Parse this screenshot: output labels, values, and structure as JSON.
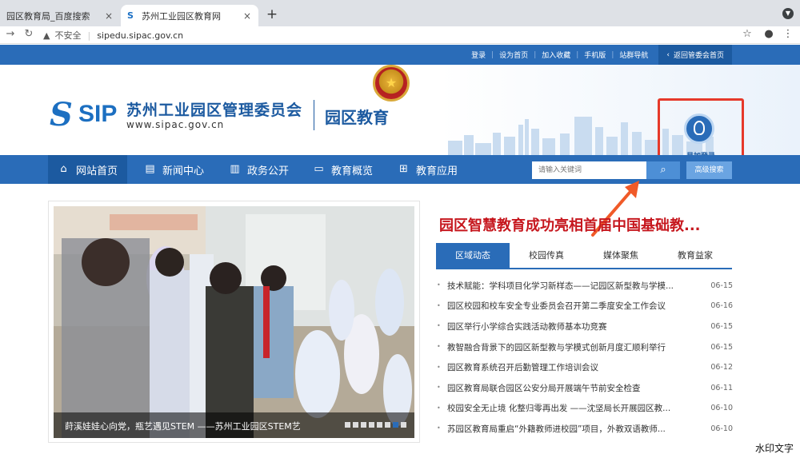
{
  "browser": {
    "tabs": [
      {
        "label": "园区教育局_百度搜索",
        "active": false
      },
      {
        "label": "苏州工业园区教育网",
        "active": true
      }
    ],
    "new_tab": "+",
    "tab_close": "×",
    "address": {
      "security_label": "不安全",
      "url": "sipedu.sipac.gov.cn"
    }
  },
  "topbar": {
    "links": [
      "登录",
      "设为首页",
      "加入收藏",
      "手机版",
      "站群导航"
    ],
    "back_link": "返回管委会首页"
  },
  "header": {
    "logo_text": "SIP",
    "org_name": "苏州工业园区管理委员会",
    "org_url": "www.sipac.gov.cn",
    "section_name": "园区教育",
    "login_label": "易加登录"
  },
  "nav": {
    "items": [
      {
        "label": "网站首页",
        "icon": "home-icon"
      },
      {
        "label": "新闻中心",
        "icon": "newspaper-icon"
      },
      {
        "label": "政务公开",
        "icon": "book-icon"
      },
      {
        "label": "教育概览",
        "icon": "monitor-icon"
      },
      {
        "label": "教育应用",
        "icon": "apps-icon"
      }
    ],
    "search_placeholder": "请输入关键词",
    "advanced_search": "高级搜索"
  },
  "carousel": {
    "caption": "莳溪娃娃心向党，瓶艺遇见STEM  ——苏州工业园区STEM艺",
    "slide_count": 8,
    "active_slide": 7
  },
  "news": {
    "headline": "园区智慧教育成功亮相首届中国基础教...",
    "tabs": [
      "区域动态",
      "校园传真",
      "媒体聚焦",
      "教育益家"
    ],
    "active_tab": 0,
    "items": [
      {
        "title": "技术赋能：学科项目化学习新样态——记园区新型教与学模...",
        "date": "06-15"
      },
      {
        "title": "园区校园和校车安全专业委员会召开第二季度安全工作会议",
        "date": "06-16"
      },
      {
        "title": "园区举行小学综合实践活动教师基本功竞赛",
        "date": "06-15"
      },
      {
        "title": "教智融合背景下的园区新型教与学模式创新月度汇顺利举行",
        "date": "06-15"
      },
      {
        "title": "园区教育系统召开后勤管理工作培训会议",
        "date": "06-12"
      },
      {
        "title": "园区教育局联合园区公安分局开展端午节前安全检查",
        "date": "06-11"
      },
      {
        "title": "校园安全无止境 化整归零再出发 ——沈坚局长开展园区教...",
        "date": "06-10"
      },
      {
        "title": "苏园区教育局重启“外籍教师进校园”项目，外教双语教师...",
        "date": "06-10"
      }
    ]
  },
  "watermark": "水印文字",
  "colors": {
    "brand_blue": "#2a6cb8",
    "headline_red": "#c6171e",
    "annotation_red": "#e6392a",
    "annotation_arrow": "#f05a28"
  }
}
